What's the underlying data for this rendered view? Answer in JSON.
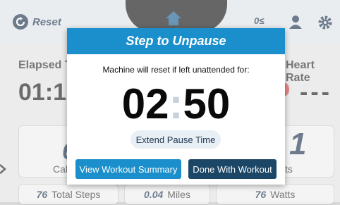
{
  "topbar": {
    "reset_label": "Reset",
    "language_label": "0≤",
    "icons": [
      "reset-icon",
      "home-icon",
      "user-icon",
      "gear-icon"
    ]
  },
  "dashboard": {
    "elapsed_label": "Elapsed Ti",
    "elapsed_value": "01:1",
    "heart_rate_label": "Heart Rate",
    "heart_rate_value": "---",
    "tile_left_label": "Cal",
    "tile_left_value": "6",
    "tile_right_label": "ts",
    "tile_right_value": "1",
    "pills": [
      {
        "value": "76",
        "label": "Total Steps"
      },
      {
        "value": "0.04",
        "label": "Miles"
      },
      {
        "value": "76",
        "label": "Watts"
      }
    ]
  },
  "modal": {
    "title": "Step to Unpause",
    "message": "Machine will reset if left unattended for:",
    "timer_minutes": "02",
    "timer_separator": ":",
    "timer_seconds": "50",
    "extend_label": "Extend Pause Time",
    "summary_label": "View Workout Summary",
    "done_label": "Done With Workout"
  },
  "colors": {
    "header_blue": "#1a8fcc",
    "navy": "#1b4666",
    "brand_dark": "#1f3550"
  }
}
